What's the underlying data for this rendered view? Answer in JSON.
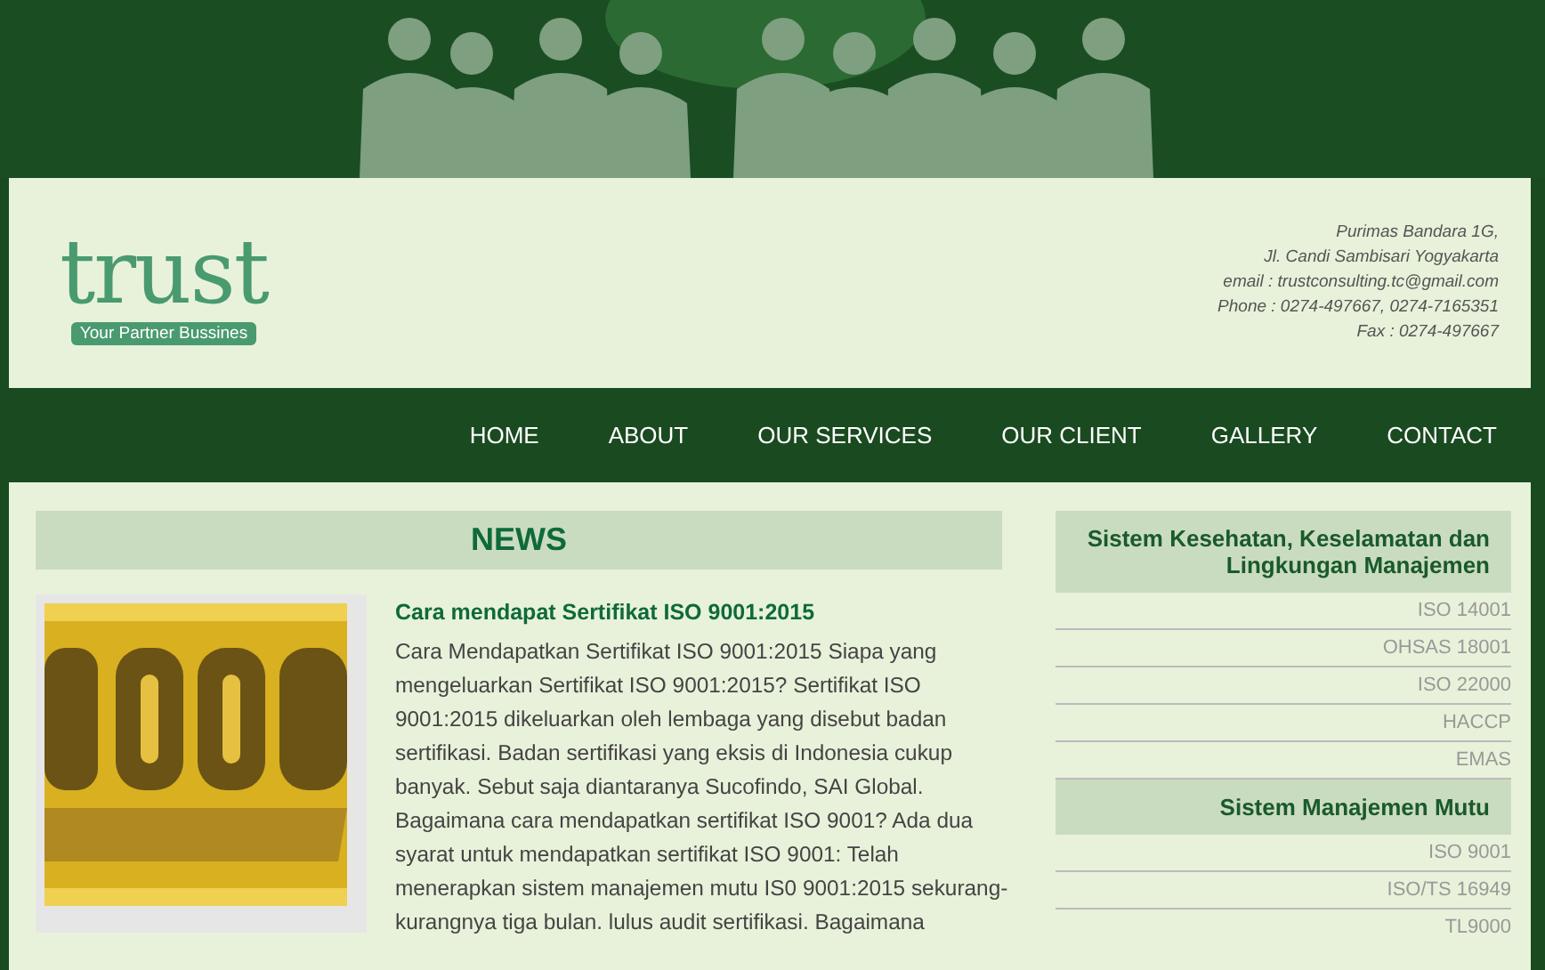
{
  "header": {
    "logo": {
      "wordmark": "trust",
      "tagline": "Your Partner Bussines"
    },
    "contact": [
      "Purimas Bandara 1G,",
      "Jl. Candi Sambisari Yogyakarta",
      "email : trustconsulting.tc@gmail.com",
      "Phone : 0274-497667, 0274-7165351",
      "Fax : 0274-497667"
    ]
  },
  "nav": [
    "HOME",
    "ABOUT",
    "OUR SERVICES",
    "OUR CLIENT",
    "GALLERY",
    "CONTACT"
  ],
  "news": {
    "title": "NEWS",
    "articles": [
      {
        "title": "Cara mendapat Sertifikat ISO 9001:2015",
        "body": "Cara Mendapatkan Sertifikat ISO 9001:2015   Siapa yang mengeluarkan Sertifikat ISO 9001:2015? Sertifikat ISO 9001:2015 dikeluarkan oleh lembaga yang disebut badan sertifikasi. Badan sertifikasi yang eksis di Indonesia cukup banyak. Sebut saja diantaranya Sucofindo, SAI Global. Bagaimana cara mendapatkan sertifikat ISO 9001? Ada dua syarat untuk mendapatkan sertifikat ISO 9001: Telah menerapkan sistem manajemen mutu IS0 9001:2015 sekurang-kurangnya tiga bulan. lulus audit sertifikasi.  Bagaimana"
      }
    ]
  },
  "sidebar": [
    {
      "title": "Sistem Kesehatan, Keselamatan dan Lingkungan Manajemen",
      "items": [
        "ISO 14001",
        "OHSAS 18001",
        "ISO 22000",
        "HACCP",
        "EMAS"
      ]
    },
    {
      "title": "Sistem Manajemen Mutu",
      "items": [
        "ISO 9001",
        "ISO/TS 16949",
        "TL9000"
      ]
    }
  ]
}
